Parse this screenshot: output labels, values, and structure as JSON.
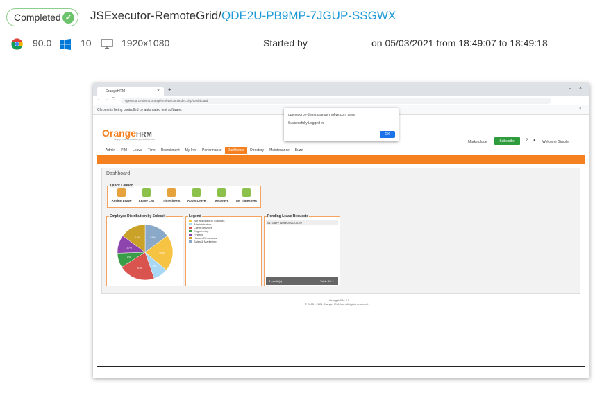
{
  "header": {
    "status": "Completed",
    "project": "JSExecutor-RemoteGrid",
    "separator": "/",
    "session_id": "QDE2U-PB9MP-7JGUP-SSGWX"
  },
  "meta": {
    "browser_version": "90.0",
    "os_version": "10",
    "resolution": "1920x1080",
    "started_by": "Started by",
    "time_range": "on 05/03/2021 from 18:49:07 to 18:49:18"
  },
  "colors": {
    "accent": "#1e9bd7",
    "success": "#6cc36c",
    "orange": "#f48020",
    "green_btn": "#2e9c3c"
  },
  "screenshot": {
    "tab_title": "OrangeHRM",
    "url": "opensource-demo.orangehrmlive.com/index.php/dashboard",
    "info_bar": "Chrome is being controlled by automated test software.",
    "alert_title": "opensource-demo.orangehrmlive.com says",
    "alert_msg": "Successfully Logged in",
    "alert_ok": "OK",
    "logo": {
      "orange": "Orange",
      "hrm": "HRM"
    },
    "logo_tagline": "simply your innovation pays dividends",
    "marketplace": "Marketplace",
    "subscribe": "Subscribe",
    "welcome": "Welcome Gimple",
    "nav": [
      "Admin",
      "PIM",
      "Leave",
      "Time",
      "Recruitment",
      "My Info",
      "Performance",
      "Dashboard",
      "Directory",
      "Maintenance",
      "Buzz"
    ],
    "dashboard_title": "Dashboard",
    "quick_launch_title": "Quick Launch",
    "quick_launch": [
      "Assign Leave",
      "Leave List",
      "Timesheets",
      "Apply Leave",
      "My Leave",
      "My Timesheet"
    ],
    "emp_dist_title": "Employee Distribution by Subunit",
    "legend_title": "Legend",
    "legend": [
      "Not assigned to Subunits",
      "Administration",
      "Client Services",
      "Engineering",
      "Finance",
      "Human Resources",
      "Sales & Marketing"
    ],
    "pending_title": "Pending Leave Requests",
    "pending_row": "01. Garry White 2021-05-20",
    "pending_footer_left": "3 month(s)",
    "pending_footer_right": "Total : 1 / 1",
    "footer_line1": "OrangeHRM 4.5",
    "footer_line2": "© 2005 - 2021 OrangeHRM, Inc. All rights reserved.",
    "pie_labels": [
      "14%",
      "20%",
      "8%",
      "20%",
      "8%",
      "10%",
      "14%"
    ]
  }
}
